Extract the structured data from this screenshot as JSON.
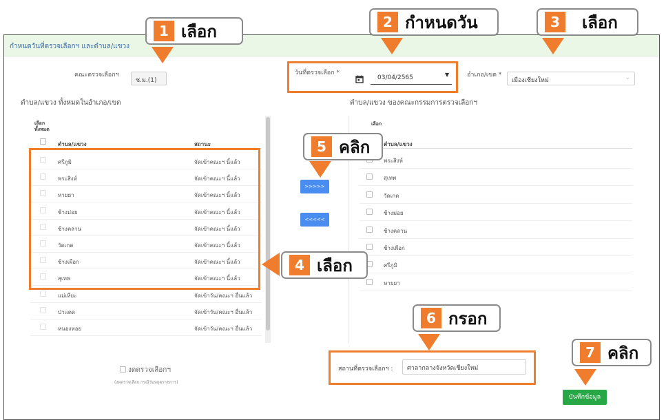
{
  "header": {
    "title": "กำหนดวันที่ตรวจเลือกฯ และตำบล/แขวง"
  },
  "form": {
    "committee_label": "คณะตรวจเลือกฯ",
    "committee_value": "ช.ม.(1)",
    "date_label": "วันที่ตรวจเลือก *",
    "date_value": "03/04/2565",
    "district_label": "อำเภอ/เขต *",
    "district_value": "เมืองเชียงใหม่"
  },
  "left_panel": {
    "title": "ตำบล/แขวง ทั้งหมดในอำเภอ/เขต",
    "select_all_label": "เลือกทั้งหมด",
    "col_subdistrict": "ตำบล/แขวง",
    "col_status": "สถานะ",
    "rows": [
      {
        "name": "ศรีภูมิ",
        "status": "จัดเข้าคณะฯ นี้แล้ว"
      },
      {
        "name": "พระสิงห์",
        "status": "จัดเข้าคณะฯ นี้แล้ว"
      },
      {
        "name": "หายยา",
        "status": "จัดเข้าคณะฯ นี้แล้ว"
      },
      {
        "name": "ช้างม่อย",
        "status": "จัดเข้าคณะฯ นี้แล้ว"
      },
      {
        "name": "ช้างคลาน",
        "status": "จัดเข้าคณะฯ นี้แล้ว"
      },
      {
        "name": "วัดเกต",
        "status": "จัดเข้าคณะฯ นี้แล้ว"
      },
      {
        "name": "ช้างเผือก",
        "status": "จัดเข้าคณะฯ นี้แล้ว"
      },
      {
        "name": "สุเทพ",
        "status": "จัดเข้าคณะฯ นี้แล้ว"
      },
      {
        "name": "แม่เหียะ",
        "status": "จัดเข้าวัน/คณะฯ อื่นแล้ว"
      },
      {
        "name": "ป่าแดด",
        "status": "จัดเข้าวัน/คณะฯ อื่นแล้ว"
      },
      {
        "name": "หนองหอย",
        "status": "จัดเข้าวัน/คณะฯ อื่นแล้ว"
      }
    ]
  },
  "right_panel": {
    "title": "ตำบล/แขวง ของคณะกรรมการตรวจเลือกฯ",
    "select_label": "เลือก",
    "col_subdistrict": "ตำบล/แขวง",
    "rows": [
      "พระสิงห์",
      "สุเทพ",
      "วัดเกต",
      "ช้างม่อย",
      "ช้างคลาน",
      "ช้างเผือก",
      "ศรีภูมิ",
      "หายยา"
    ]
  },
  "buttons": {
    "move_right": ">>>>>",
    "move_left": "<<<<<",
    "save": "บันทึกข้อมูล"
  },
  "cancel": {
    "label": "งดตรวจเลือกฯ",
    "note": "(งดตรวจเลือก กรณีวันหยุดราชการ)"
  },
  "location": {
    "label": "สถานที่ตรวจเลือกฯ :",
    "value": "ศาลากลางจังหวัดเชียงใหม่"
  },
  "annotations": [
    {
      "num": "1",
      "text": "เลือก"
    },
    {
      "num": "2",
      "text": "กำหนดวัน"
    },
    {
      "num": "3",
      "text": "เลือก"
    },
    {
      "num": "4",
      "text": "เลือก"
    },
    {
      "num": "5",
      "text": "คลิก"
    },
    {
      "num": "6",
      "text": "กรอก"
    },
    {
      "num": "7",
      "text": "คลิก"
    }
  ],
  "colors": {
    "annotation": "#ef7d2d",
    "header_bg": "#eaf6e6",
    "move_button": "#4a8df0",
    "save_button": "#27a745"
  }
}
